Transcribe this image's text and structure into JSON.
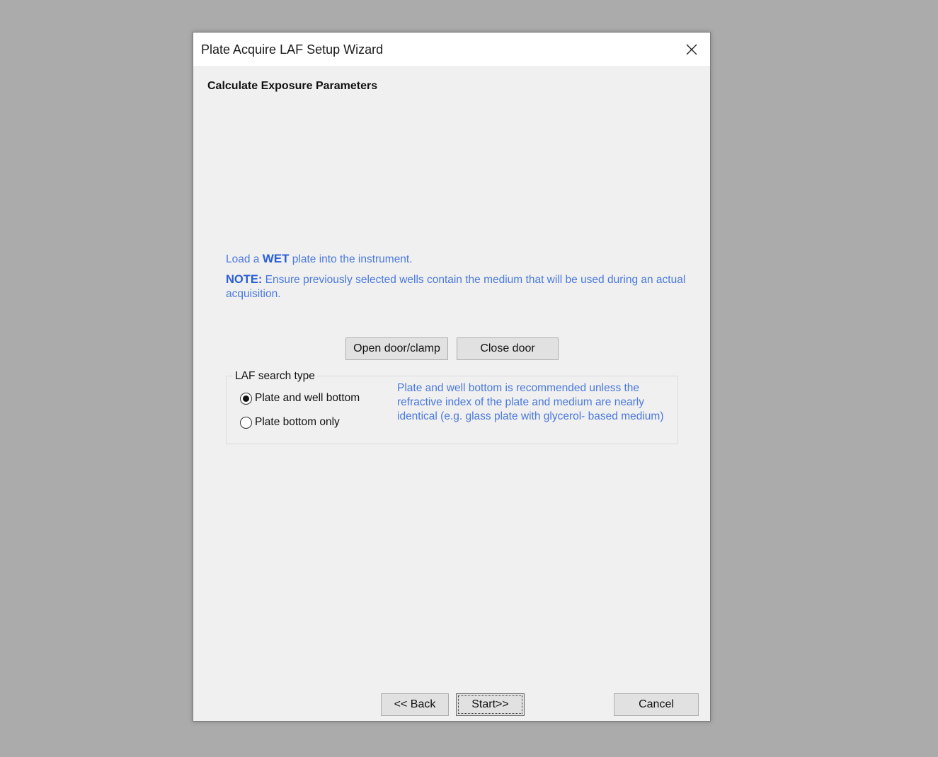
{
  "window": {
    "title": "Plate Acquire LAF Setup Wizard"
  },
  "page": {
    "section_title": "Calculate Exposure Parameters"
  },
  "instructions": {
    "load_prefix": "Load a ",
    "load_emphasis": "WET",
    "load_suffix": " plate into the instrument.",
    "note_label": "NOTE:",
    "note_text": " Ensure previously selected  wells contain the medium that will be used during an actual acquisition."
  },
  "door_buttons": {
    "open_label": "Open door/clamp",
    "close_label": "Close door"
  },
  "laf_search": {
    "legend": "LAF search type",
    "options": [
      {
        "label": "Plate and well bottom",
        "selected": true
      },
      {
        "label": "Plate bottom only",
        "selected": false
      }
    ],
    "hint": "Plate and well bottom is recommended unless the refractive index of the plate and medium are nearly identical (e.g. glass plate with glycerol- based medium)"
  },
  "footer": {
    "back_label": "<< Back",
    "start_label": "Start>>",
    "cancel_label": "Cancel"
  },
  "colors": {
    "hint_blue": "#4a78dc",
    "window_bg": "#f0f0f0",
    "desktop_bg": "#ababab"
  }
}
